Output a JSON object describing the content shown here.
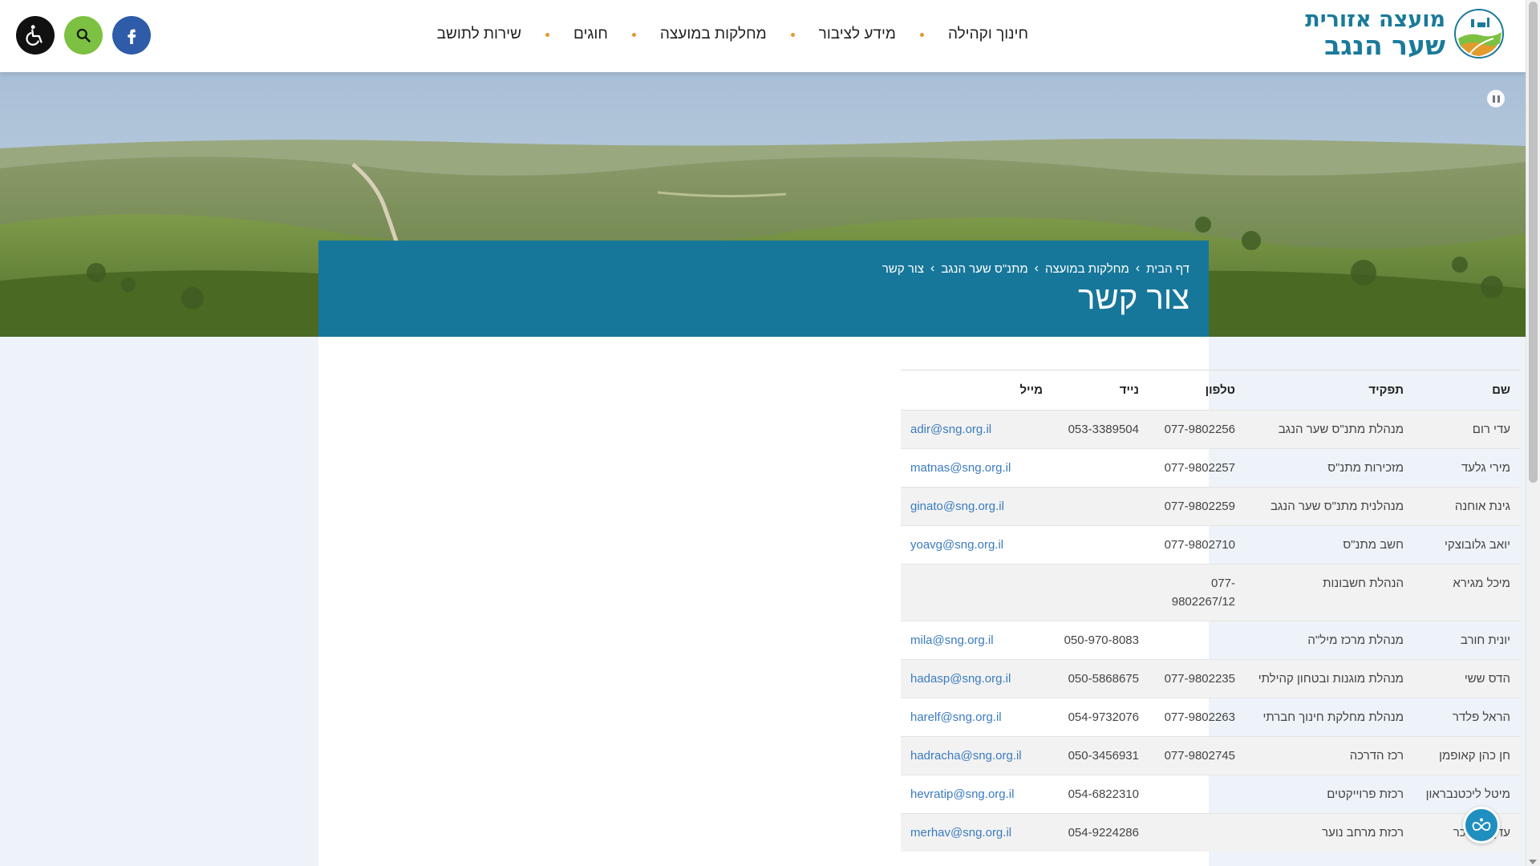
{
  "logo": {
    "line1": "מועצה אזורית",
    "line2": "שער הנגב"
  },
  "nav": [
    {
      "label": "חינוך וקהילה"
    },
    {
      "label": "מידע לציבור"
    },
    {
      "label": "מחלקות במועצה"
    },
    {
      "label": "חוגים"
    },
    {
      "label": "שירות לתושב"
    }
  ],
  "breadcrumb": [
    "דף הבית",
    "מחלקות במועצה",
    "מתנ\"ס שער הנגב",
    "צור קשר"
  ],
  "page_title": "צור קשר",
  "table": {
    "headers": {
      "name": "שם",
      "role": "תפקיד",
      "phone": "טלפון",
      "mobile": "נייד",
      "email": "מייל"
    },
    "rows": [
      {
        "name": "עדי רום",
        "role": "מנהלת מתנ\"ס שער הנגב",
        "phone": "077-9802256",
        "mobile": "053-3389504",
        "email": "adir@sng.org.il"
      },
      {
        "name": "מירי גלעד",
        "role": "מזכירות מתנ\"ס",
        "phone": "077-9802257",
        "mobile": "",
        "email": "matnas@sng.org.il"
      },
      {
        "name": "גינת אוחנה",
        "role": "מנהלנית מתנ\"ס שער הנגב",
        "phone": "077-9802259",
        "mobile": "",
        "email": "ginato@sng.org.il"
      },
      {
        "name": "יואב גלובוצקי",
        "role": "חשב מתנ\"ס",
        "phone": "077-9802710",
        "mobile": "",
        "email": "yoavg@sng.org.il"
      },
      {
        "name": "מיכל מגירא",
        "role": "הנהלת חשבונות",
        "phone": "077-9802267/12",
        "mobile": "",
        "email": ""
      },
      {
        "name": "יונית חורב",
        "role": "מנהלת מרכז מיל\"ה",
        "phone": "",
        "mobile": "050-970-8083",
        "email": "mila@sng.org.il"
      },
      {
        "name": "הדס ששי",
        "role": "מנהלת מוגנות ובטחון קהילתי",
        "phone": "077-9802235",
        "mobile": "050-5868675",
        "email": "hadasp@sng.org.il"
      },
      {
        "name": "הראל פלדר",
        "role": "מנהלת מחלקת חינוך חברתי",
        "phone": "077-9802263",
        "mobile": "054-9732076",
        "email": "harelf@sng.org.il"
      },
      {
        "name": "חן כהן קאופמן",
        "role": "רכז הדרכה",
        "phone": "077-9802745",
        "mobile": "050-3456931",
        "email": "hadracha@sng.org.il"
      },
      {
        "name": "מיטל ליכטנבראון",
        "role": "רכזת פרוייקטים",
        "phone": "",
        "mobile": "054-6822310",
        "email": "hevratip@sng.org.il"
      },
      {
        "name": "עדן ראובכר",
        "role": "רכזת מרחב נוער",
        "phone": "",
        "mobile": "054-9224286",
        "email": "merhav@sng.org.il"
      }
    ]
  },
  "colors": {
    "brand_teal": "#17779a",
    "accent_orange": "#e39a2c",
    "search_green": "#7cc142",
    "facebook_blue": "#2f5ca8",
    "link_blue": "#3a7bbf"
  },
  "icons": [
    "accessibility-icon",
    "search-icon",
    "facebook-icon",
    "pause-icon",
    "widget-icon",
    "logo-icon"
  ]
}
